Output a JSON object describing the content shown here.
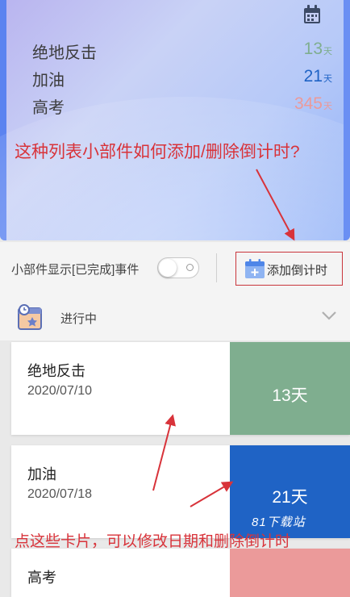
{
  "widget": {
    "items": [
      {
        "name": "绝地反击",
        "value": "13",
        "unit": "天",
        "color": "#7fae8f"
      },
      {
        "name": "加油",
        "value": "21",
        "unit": "天",
        "color": "#1f63c5"
      },
      {
        "name": "高考",
        "value": "345",
        "unit": "天",
        "color": "#eb9a9a"
      }
    ]
  },
  "annotations": {
    "top": "这种列表小部件如何添加/删除倒计时?",
    "bottom": "点这些卡片，可以修改日期和删除倒计时",
    "color": "#d8333a"
  },
  "controls": {
    "show_completed_label": "小部件显示[已完成]事件",
    "show_completed_on": false,
    "add_button_label": "添加倒计时"
  },
  "section": {
    "title": "进行中"
  },
  "cards": [
    {
      "name": "绝地反击",
      "date": "2020/07/10",
      "days": "13天",
      "color": "#7fae8f"
    },
    {
      "name": "加油",
      "date": "2020/07/18",
      "days": "21天",
      "color": "#1f63c5"
    },
    {
      "name": "高考",
      "date": "",
      "days": "",
      "color": "#eb9a9a"
    }
  ],
  "watermark": "81下载站"
}
